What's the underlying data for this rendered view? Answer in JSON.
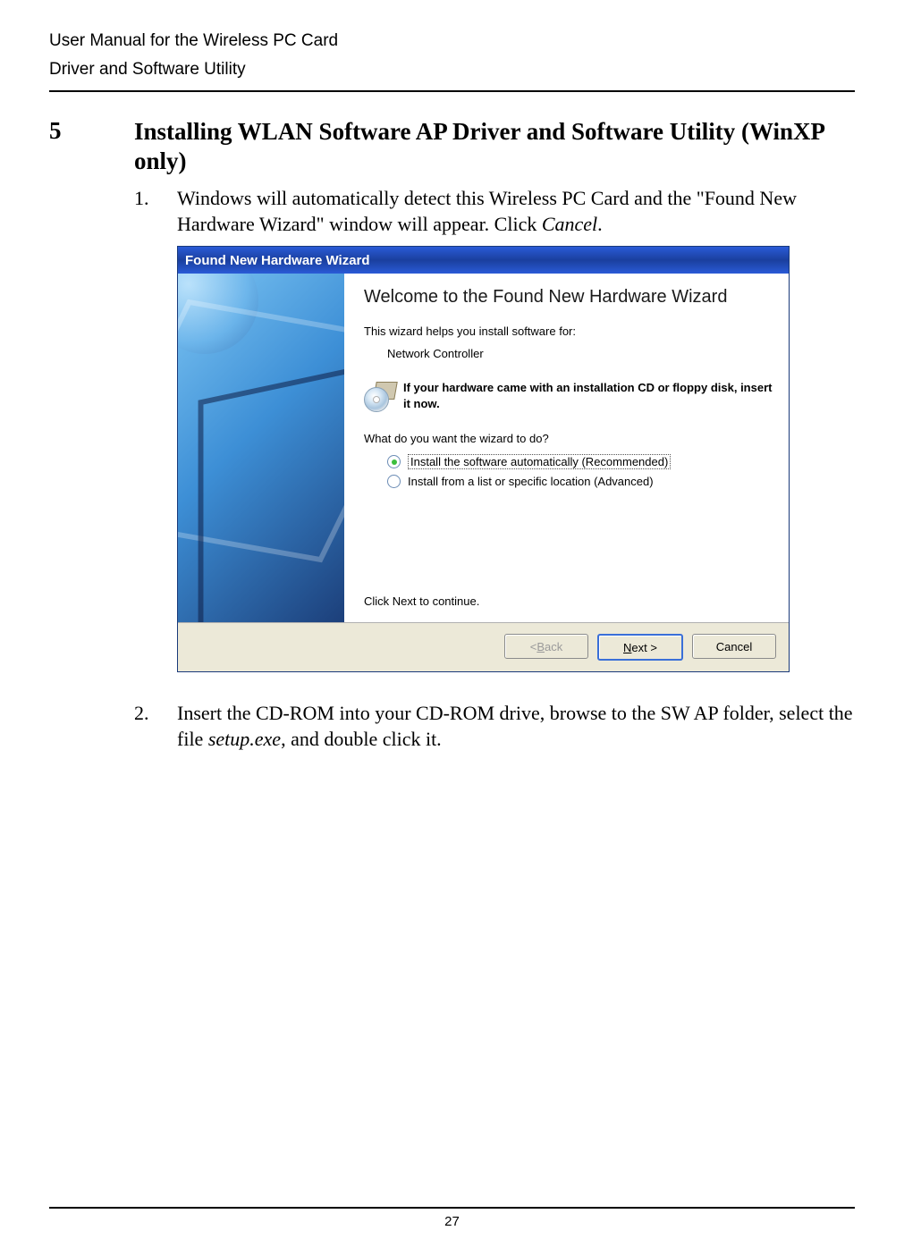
{
  "header": {
    "line1": "User Manual for the Wireless PC Card",
    "line2": "Driver and Software Utility"
  },
  "section": {
    "number": "5",
    "title": "Installing WLAN Software AP Driver and Software Utility (WinXP only)"
  },
  "steps": {
    "s1": {
      "num": "1.",
      "text_a": "Windows will automatically detect this Wireless PC Card and the \"Found New Hardware Wizard\" window will appear. Click ",
      "text_em": "Cancel",
      "text_b": "."
    },
    "s2": {
      "num": "2.",
      "text_a": "Insert the CD-ROM into your CD-ROM drive, browse to the SW AP folder, select the file ",
      "text_em": "setup.exe",
      "text_b": ", and double click it."
    }
  },
  "wizard": {
    "titlebar": "Found New Hardware Wizard",
    "heading": "Welcome to the Found New Hardware Wizard",
    "intro": "This wizard helps you install software for:",
    "device": "Network Controller",
    "cd_note": "If your hardware came with an installation CD or floppy disk, insert it now.",
    "question": "What do you want the wizard to do?",
    "opt1": "Install the software automatically (Recommended)",
    "opt2": "Install from a list or specific location (Advanced)",
    "click_next": "Click Next to continue.",
    "buttons": {
      "back_pre": "< ",
      "back_u": "B",
      "back_post": "ack",
      "next_u": "N",
      "next_post": "ext >",
      "cancel": "Cancel"
    }
  },
  "page_number": "27"
}
